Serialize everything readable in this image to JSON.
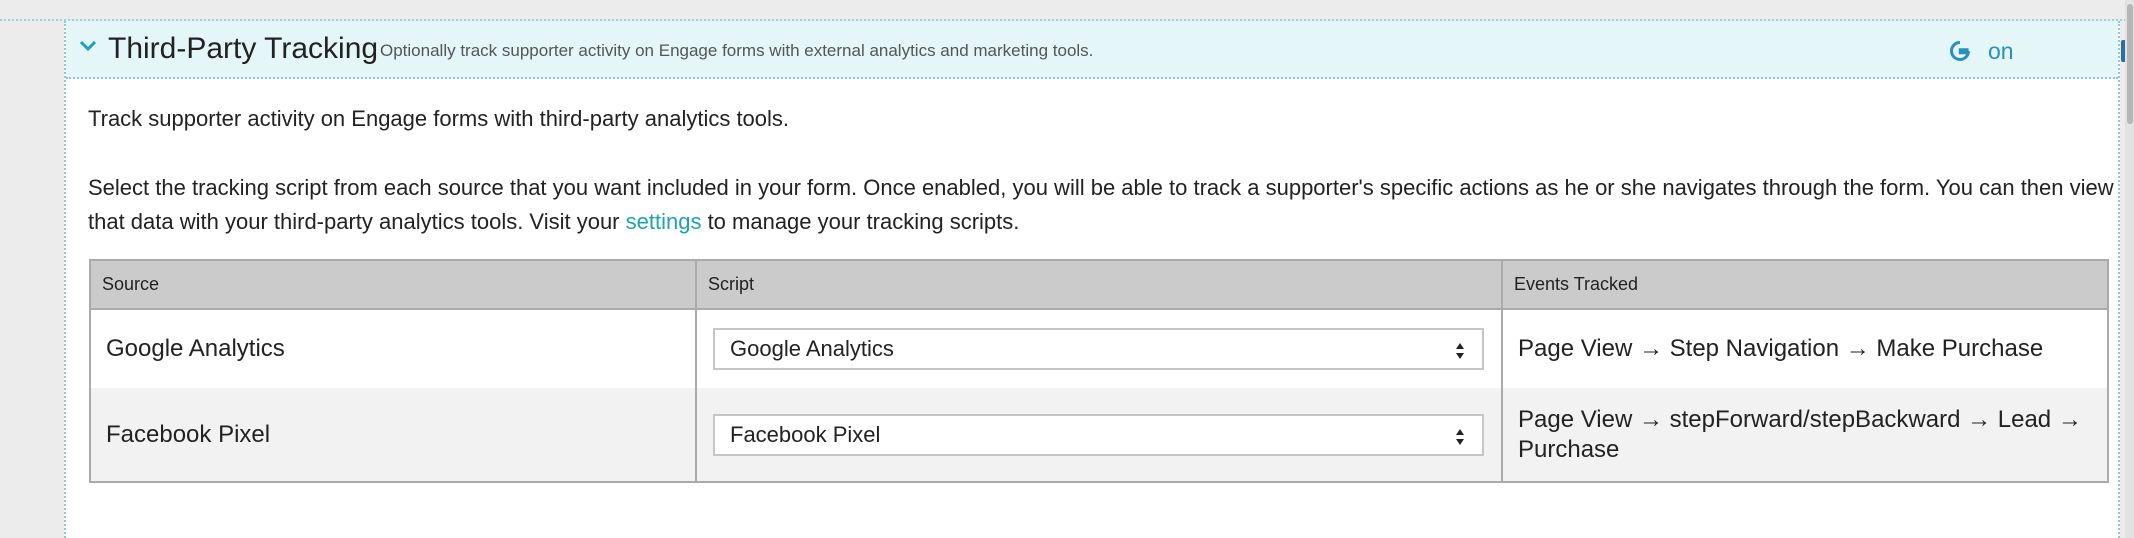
{
  "section": {
    "title": "Third-Party Tracking",
    "subtitle": "Optionally track supporter activity on Engage forms with external analytics and marketing tools.",
    "status": [
      {
        "icon": "google-icon",
        "label": "on"
      },
      {
        "icon": "facebook-icon",
        "label": "on"
      }
    ]
  },
  "intro": {
    "line1": "Track supporter activity on Engage forms with third-party analytics tools.",
    "line2_before": "Select the tracking script from each source that you want included in your form. Once enabled, you will be able to track a supporter's specific actions as he or she navigates through the form. You can then view that data with your third-party analytics tools. Visit your ",
    "link": "settings",
    "line2_after": " to manage your tracking scripts."
  },
  "table": {
    "headers": [
      "Source",
      "Script",
      "Events Tracked"
    ],
    "rows": [
      {
        "source": "Google Analytics",
        "script": "Google Analytics",
        "events": "Page View → Step Navigation → Make Purchase"
      },
      {
        "source": "Facebook Pixel",
        "script": "Facebook Pixel",
        "events": "Page View → stepForward/stepBackward → Lead → Purchase"
      }
    ]
  },
  "colors": {
    "accent": "#1ea2b6",
    "status_link": "#2a8fbd",
    "header_bg": "#e4f6f8"
  }
}
